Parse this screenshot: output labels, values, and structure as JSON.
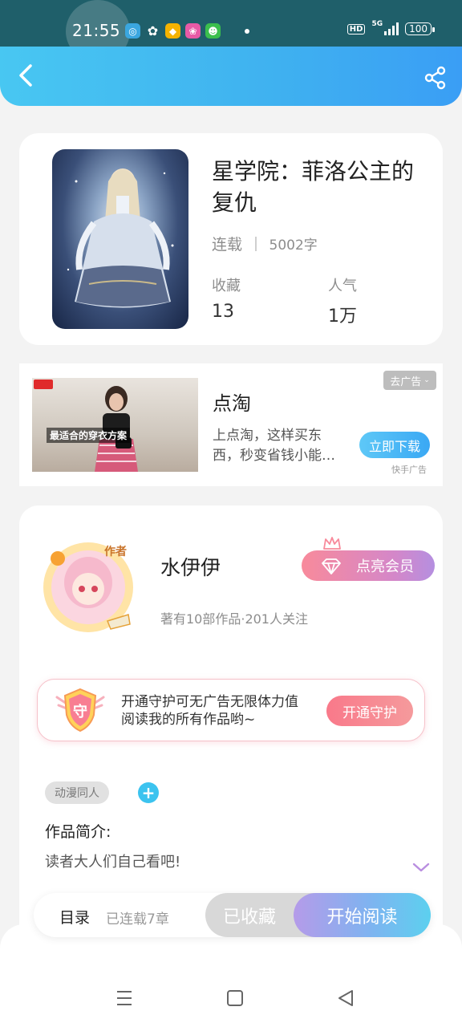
{
  "status_bar": {
    "time": "21:55",
    "hd": "HD",
    "network": "5G",
    "battery": "100"
  },
  "header": {
    "back_icon": "chevron-left-icon",
    "share_icon": "share-icon"
  },
  "book": {
    "title": "星学院：菲洛公主的复仇",
    "status": "连载",
    "word_count": "5002字",
    "favorites_label": "收藏",
    "favorites_value": "13",
    "popularity_label": "人气",
    "popularity_value": "1万"
  },
  "ad": {
    "image_caption": "最适合的穿衣方案",
    "title": "点淘",
    "description": "上点淘，这样买东西，秒变省钱小能…",
    "close_label": "去广告",
    "cta_label": "立即下载",
    "source": "快手广告"
  },
  "author": {
    "badge": "作者",
    "name": "水伊伊",
    "stats": "著有10部作品·201人关注",
    "vip_label": "点亮会员",
    "guard_badge": "守",
    "guard_text_line1": "开通守护可无广告无限体力值",
    "guard_text_line2": "阅读我的所有作品哟~",
    "guard_button": "开通守护",
    "tag": "动漫同人",
    "tag_add": "+",
    "intro_label": "作品简介:",
    "intro_text": "读者大人们自己看吧!"
  },
  "action_bar": {
    "toc_label": "目录",
    "toc_count": "已连载7章",
    "collect_label": "已收藏",
    "read_label": "开始阅读"
  },
  "colors": {
    "header_gradient": [
      "#48c7f2",
      "#3a9ef5"
    ],
    "read_gradient": [
      "#b59be9",
      "#5cd0ef"
    ],
    "guard_pink": "#f9798a"
  }
}
